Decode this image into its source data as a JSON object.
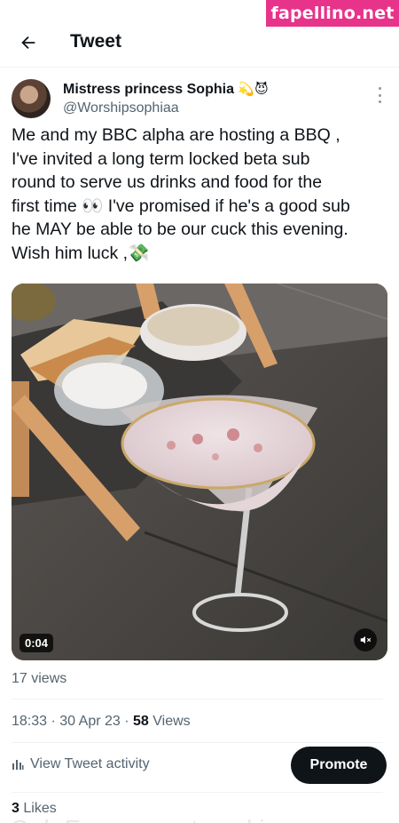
{
  "watermark": "fapellino.net",
  "header": {
    "title": "Tweet",
    "back_icon": "arrow-left-icon"
  },
  "author": {
    "name": "Mistress princess Sophia",
    "name_emojis": "💫😈",
    "handle": "@Worshipsophiaa"
  },
  "tweet": {
    "lines": [
      "Me and my BBC alpha are hosting a BBQ ,",
      "I've invited a long term locked beta sub",
      "round to serve us drinks and food for the",
      "first time 👀 I've promised if he's a good sub",
      "he MAY be able to be our cuck this evening.",
      "Wish him luck ,💸"
    ]
  },
  "media": {
    "duration": "0:04",
    "mute_icon": "speaker-muted-icon"
  },
  "stats": {
    "views_count": "17 views",
    "time": "18:33",
    "date": "30 Apr 23",
    "views_number": "58",
    "views_label": "Views",
    "activity_label": "View Tweet activity",
    "promote_label": "Promote",
    "likes_number": "3",
    "likes_label": "Likes"
  },
  "cutoff_text": "Ooh Emmmmm  t      u  mki   e"
}
